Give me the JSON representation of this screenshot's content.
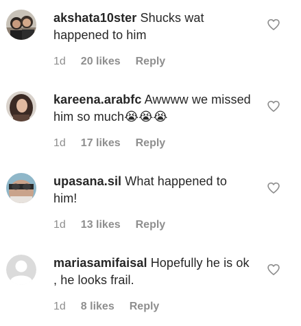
{
  "colors": {
    "text": "#262626",
    "muted": "#8e8e8e",
    "icon_stroke": "#8e8e8e"
  },
  "comments": [
    {
      "avatar": "user-photo-icon",
      "username": "akshata10ster",
      "text": "Shucks wat happened to him",
      "time": "1d",
      "likes": "20 likes",
      "reply": "Reply",
      "emojis": ""
    },
    {
      "avatar": "user-photo-icon",
      "username": "kareena.arabfc",
      "text": "Awwww we missed him so much",
      "time": "1d",
      "likes": "17 likes",
      "reply": "Reply",
      "emojis": "😭😭😭"
    },
    {
      "avatar": "user-photo-icon",
      "username": "upasana.sil",
      "text": "What happened to him!",
      "time": "1d",
      "likes": "13 likes",
      "reply": "Reply",
      "emojis": ""
    },
    {
      "avatar": "default-avatar-icon",
      "username": "mariasamifaisal",
      "text": "Hopefully he is ok , he looks frail.",
      "time": "1d",
      "likes": "8 likes",
      "reply": "Reply",
      "emojis": ""
    }
  ]
}
